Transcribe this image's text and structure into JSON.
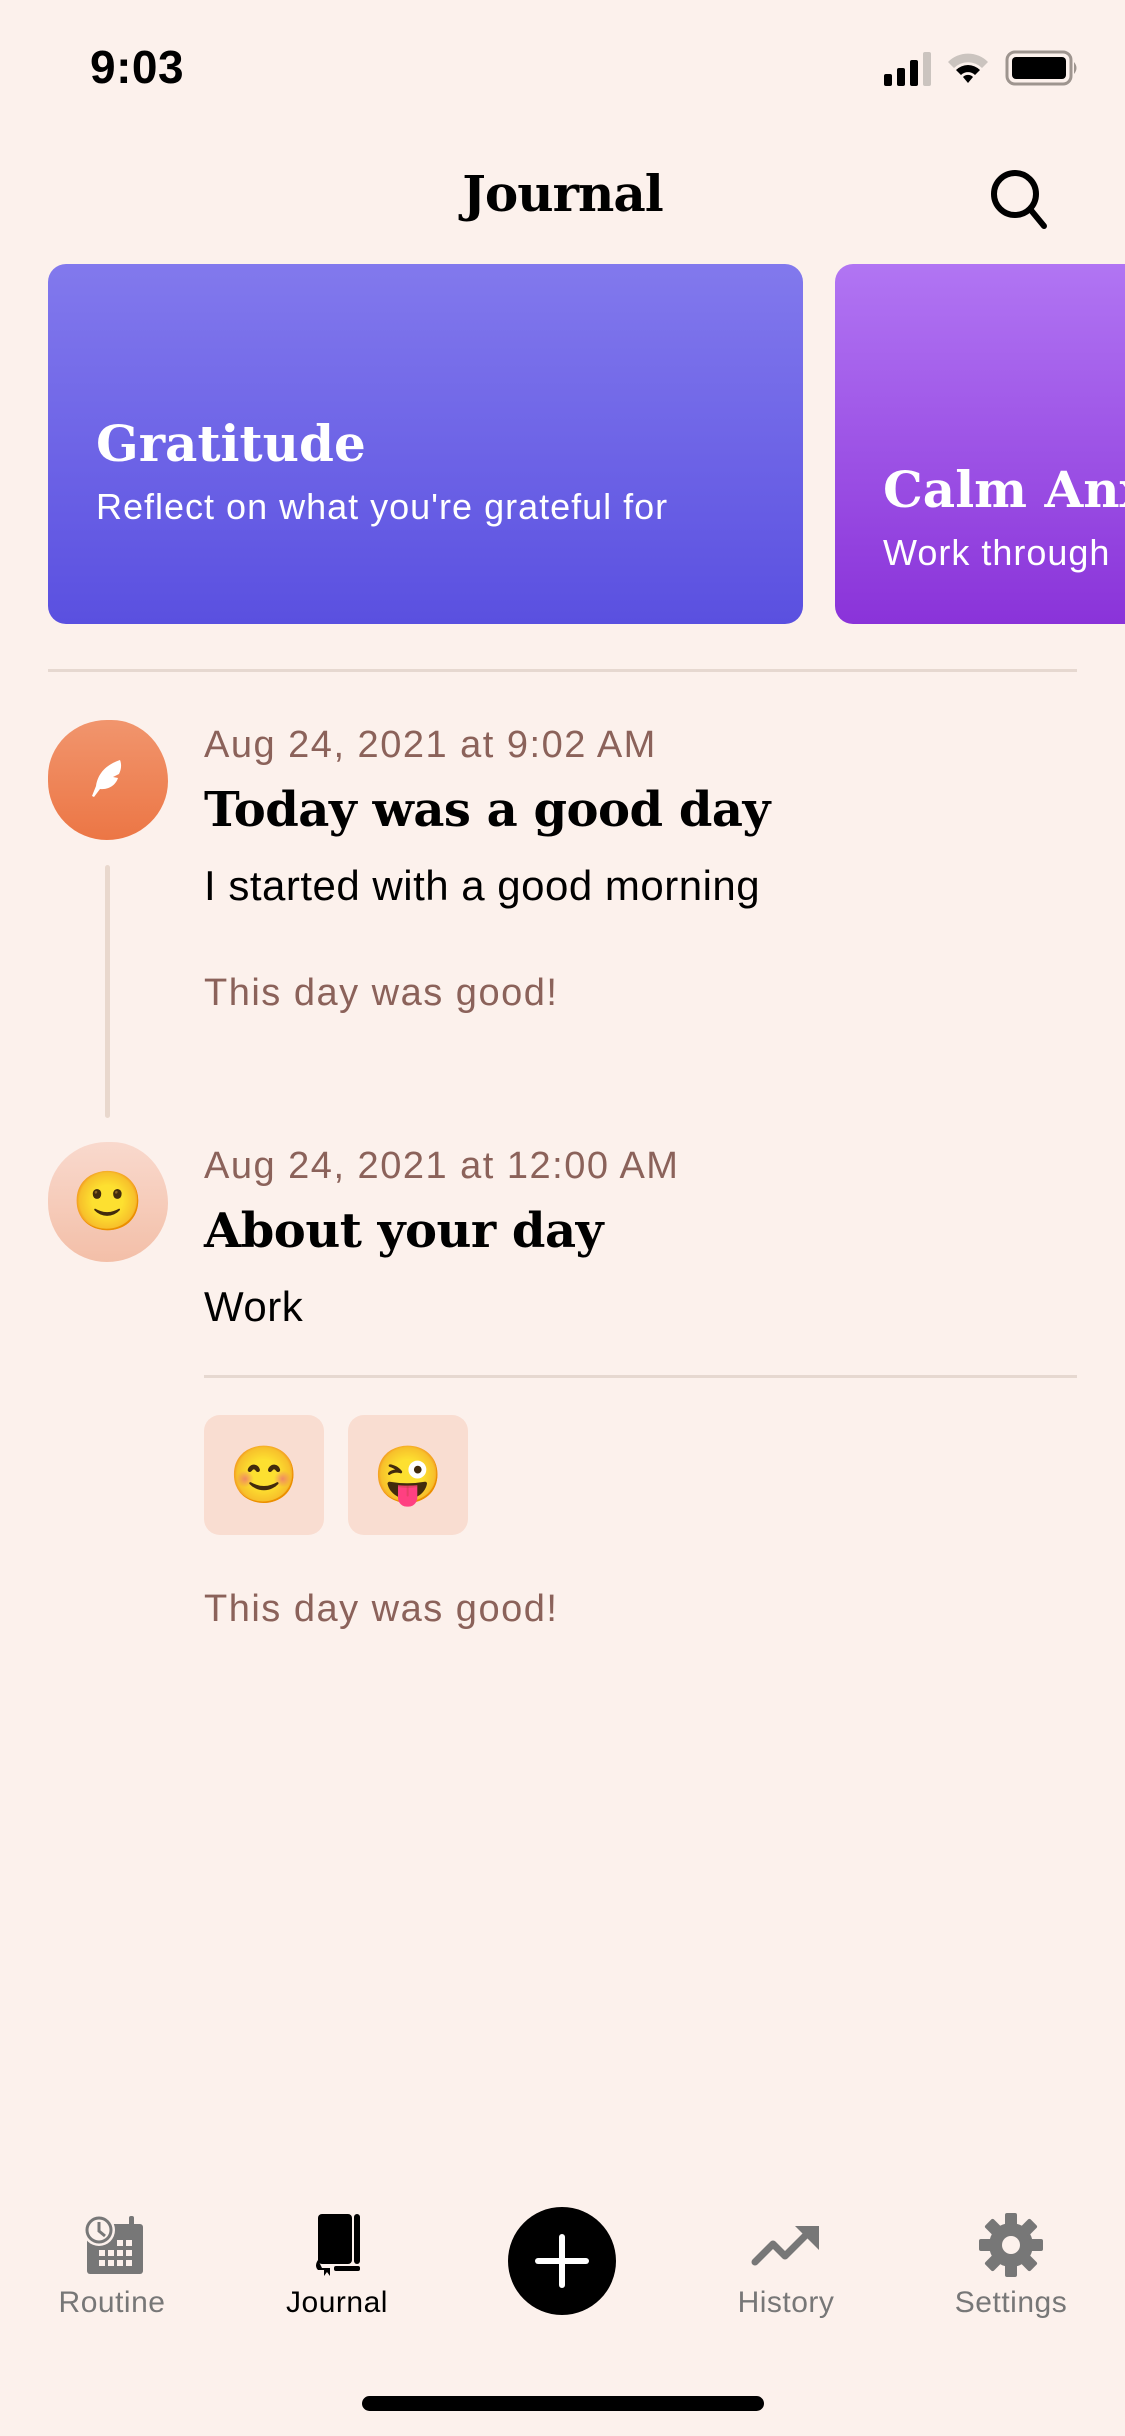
{
  "status_bar": {
    "time": "9:03",
    "icons": [
      "cellular-signal-icon",
      "wifi-icon",
      "battery-icon"
    ]
  },
  "header": {
    "title": "Journal",
    "search_icon": "search-icon"
  },
  "prompt_cards": [
    {
      "title": "Gratitude",
      "subtitle": "Reflect on what you're grateful for",
      "color_top": "#8279ed",
      "color_bottom": "#5a50e0"
    },
    {
      "title": "Calm Anxiety",
      "subtitle": "Work through",
      "color_top": "#b175f3",
      "color_bottom": "#8a33d9"
    }
  ],
  "entries": [
    {
      "icon": "feather-icon",
      "date": "Aug 24, 2021 at 9:02 AM",
      "title": "Today was a good day",
      "body": "I started with a good morning",
      "note": "This day was good!",
      "avatar_color": "#ee804f"
    },
    {
      "icon": "🙂",
      "date": "Aug 24, 2021 at 12:00 AM",
      "title": "About your day",
      "body": "Work",
      "moods": [
        "😊",
        "😜"
      ],
      "note": "This day was good!",
      "avatar_color": "#f6cbb9"
    }
  ],
  "tab_bar": {
    "tabs": [
      {
        "label": "Routine",
        "icon": "routine-calendar-icon",
        "active": false
      },
      {
        "label": "Journal",
        "icon": "journal-book-icon",
        "active": true
      },
      {
        "label": "History",
        "icon": "trend-arrow-icon",
        "active": false
      },
      {
        "label": "Settings",
        "icon": "gear-icon",
        "active": false
      }
    ],
    "add_button_icon": "plus-icon"
  },
  "colors": {
    "background": "#fcf1ec",
    "muted_text": "#8b625a",
    "inactive_tab": "#777777"
  }
}
